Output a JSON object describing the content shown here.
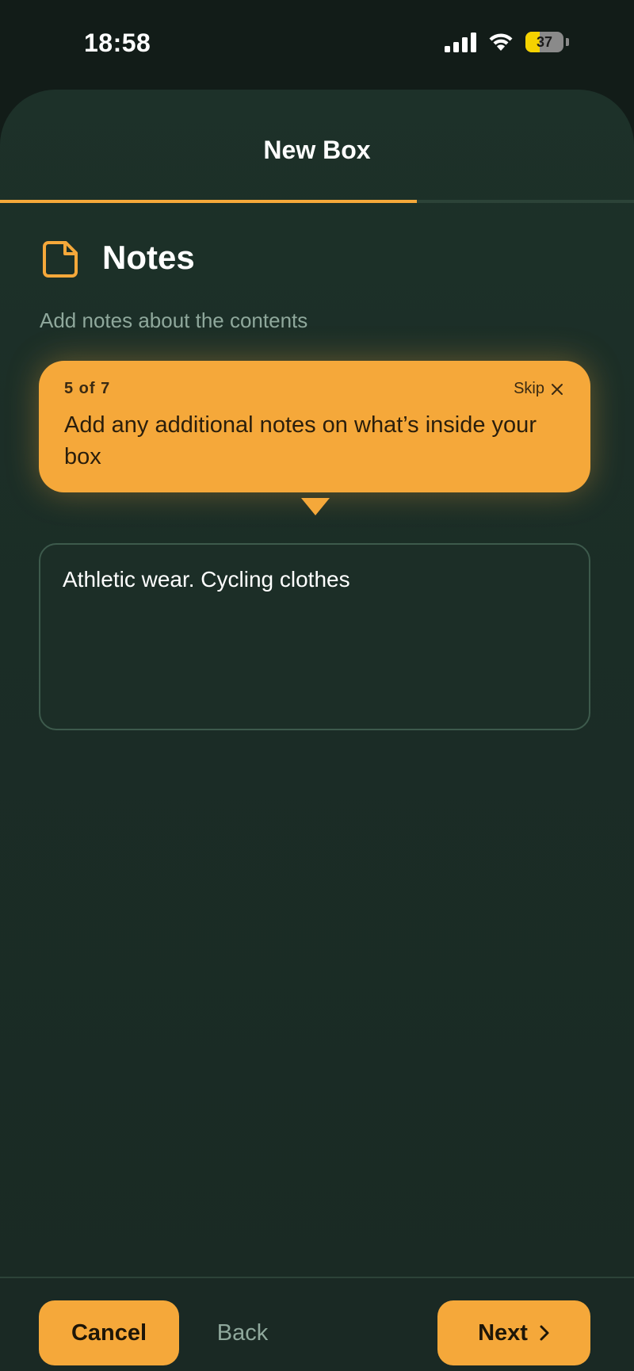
{
  "status_bar": {
    "time": "18:58",
    "battery_level": "37",
    "battery_fraction": 0.37,
    "icons": [
      "signal-icon",
      "wifi-icon",
      "battery-icon"
    ]
  },
  "header": {
    "title": "New Box",
    "progress_fraction": 0.6575
  },
  "section": {
    "icon": "note-icon",
    "title": "Notes",
    "subtitle": "Add notes about the contents"
  },
  "tooltip": {
    "step": "5 of 7",
    "skip_label": "Skip",
    "text": "Add any additional notes on what’s inside your box"
  },
  "notes_field": {
    "value": "Athletic wear. Cycling clothes"
  },
  "footer": {
    "cancel_label": "Cancel",
    "back_label": "Back",
    "next_label": "Next"
  },
  "colors": {
    "accent": "#f5a83a",
    "background": "#1b2d26",
    "muted_text": "#8fa89c"
  }
}
